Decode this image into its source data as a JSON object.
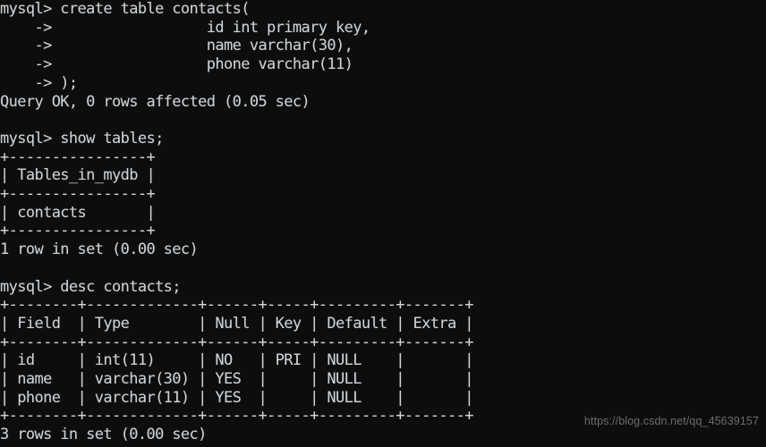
{
  "terminal": {
    "kind": "mysql-client-console",
    "prompt": "mysql>",
    "continuation_prompt": "->",
    "colors": {
      "background": "#0d0d0d",
      "foreground": "#cdd3d8",
      "watermark": "#6d6d6d"
    },
    "blocks": [
      {
        "id": "create-table-block",
        "command_lines": [
          "mysql> create table contacts(",
          "    ->                  id int primary key,",
          "    ->                  name varchar(30),",
          "    ->                  phone varchar(11)",
          "    -> );"
        ],
        "result_lines": [
          "Query OK, 0 rows affected (0.05 sec)"
        ]
      },
      {
        "id": "show-tables-block",
        "command_lines": [
          "mysql> show tables;"
        ],
        "result_lines": [
          "+----------------+",
          "| Tables_in_mydb |",
          "+----------------+",
          "| contacts       |",
          "+----------------+",
          "1 row in set (0.00 sec)"
        ]
      },
      {
        "id": "desc-contacts-block",
        "command_lines": [
          "mysql> desc contacts;"
        ],
        "result_lines": [
          "+--------+-------------+------+-----+---------+-------+",
          "| Field  | Type        | Null | Key | Default | Extra |",
          "+--------+-------------+------+-----+---------+-------+",
          "| id     | int(11)     | NO   | PRI | NULL    |       |",
          "| name   | varchar(30) | YES  |     | NULL    |       |",
          "| phone  | varchar(11) | YES  |     | NULL    |       |",
          "+--------+-------------+------+-----+---------+-------+",
          "3 rows in set (0.00 sec)"
        ]
      }
    ],
    "full_text": "mysql> create table contacts(\n    ->                  id int primary key,\n    ->                  name varchar(30),\n    ->                  phone varchar(11)\n    -> );\nQuery OK, 0 rows affected (0.05 sec)\n\nmysql> show tables;\n+----------------+\n| Tables_in_mydb |\n+----------------+\n| contacts       |\n+----------------+\n1 row in set (0.00 sec)\n\nmysql> desc contacts;\n+--------+-------------+------+-----+---------+-------+\n| Field  | Type        | Null | Key | Default | Extra |\n+--------+-------------+------+-----+---------+-------+\n| id     | int(11)     | NO   | PRI | NULL    |       |\n| name   | varchar(30) | YES  |     | NULL    |       |\n| phone  | varchar(11) | YES  |     | NULL    |       |\n+--------+-------------+------+-----+---------+-------+\n3 rows in set (0.00 sec)",
    "tables": {
      "show_tables": {
        "headers": [
          "Tables_in_mydb"
        ],
        "rows": [
          [
            "contacts"
          ]
        ],
        "footer": "1 row in set (0.00 sec)"
      },
      "desc_contacts": {
        "headers": [
          "Field",
          "Type",
          "Null",
          "Key",
          "Default",
          "Extra"
        ],
        "rows": [
          [
            "id",
            "int(11)",
            "NO",
            "PRI",
            "NULL",
            ""
          ],
          [
            "name",
            "varchar(30)",
            "YES",
            "",
            "NULL",
            ""
          ],
          [
            "phone",
            "varchar(11)",
            "YES",
            "",
            "NULL",
            ""
          ]
        ],
        "footer": "3 rows in set (0.00 sec)"
      }
    }
  },
  "watermark": {
    "text": "https://blog.csdn.net/qq_45639157"
  }
}
